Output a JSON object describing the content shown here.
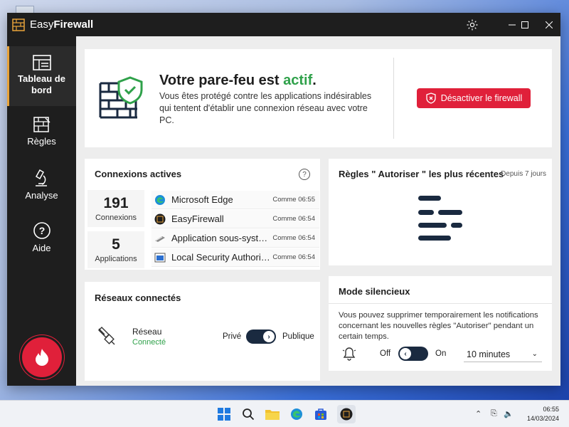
{
  "app": {
    "title_plain": "Easy",
    "title_bold": "Firewall"
  },
  "sidebar": {
    "items": [
      {
        "label": "Tableau de bord",
        "icon": "dashboard-icon",
        "active": true
      },
      {
        "label": "Règles",
        "icon": "rules-wall-icon",
        "active": false
      },
      {
        "label": "Analyse",
        "icon": "microscope-icon",
        "active": false
      },
      {
        "label": "Aide",
        "icon": "help-icon",
        "active": false
      }
    ]
  },
  "status": {
    "title_prefix": "Votre pare-feu est ",
    "title_state": "actif",
    "title_suffix": ".",
    "description": "Vous êtes protégé contre les applications indésirables qui tentent d'établir une connexion réseau avec votre PC.",
    "disable_button": "Désactiver le firewall"
  },
  "connections": {
    "title": "Connexions actives",
    "help": "?",
    "stats": [
      {
        "value": "191",
        "label": "Connexions"
      },
      {
        "value": "5",
        "label": "Applications"
      }
    ],
    "rows": [
      {
        "name": "Microsoft Edge",
        "time": "Comme 06:55",
        "icon": "edge-icon"
      },
      {
        "name": "EasyFirewall",
        "time": "Comme 06:54",
        "icon": "easyfirewall-icon"
      },
      {
        "name": "Application sous-systè...",
        "time": "Comme 06:54",
        "icon": "subsystem-app-icon"
      },
      {
        "name": "Local Security Authorit...",
        "time": "Comme 06:54",
        "icon": "security-authority-icon"
      }
    ]
  },
  "rules": {
    "title": "Règles \" Autoriser \" les plus récentes",
    "subtitle": "Depuis 7 jours"
  },
  "networks": {
    "title": "Réseaux connectés",
    "network_label": "Réseau",
    "network_status": "Connecté",
    "toggle_left": "Privé",
    "toggle_right": "Publique"
  },
  "silent": {
    "title": "Mode silencieux",
    "description": "Vous pouvez supprimer temporairement les notifications concernant les nouvelles règles \"Autoriser\" pendant un certain temps.",
    "off_label": "Off",
    "on_label": "On",
    "duration": "10 minutes"
  },
  "taskbar": {
    "time": "06:55",
    "date": "14/03/2024"
  },
  "colors": {
    "accent_red": "#e0203a",
    "active_green": "#2fa14a",
    "dark": "#1e1e1e",
    "navy": "#1a2a40"
  }
}
